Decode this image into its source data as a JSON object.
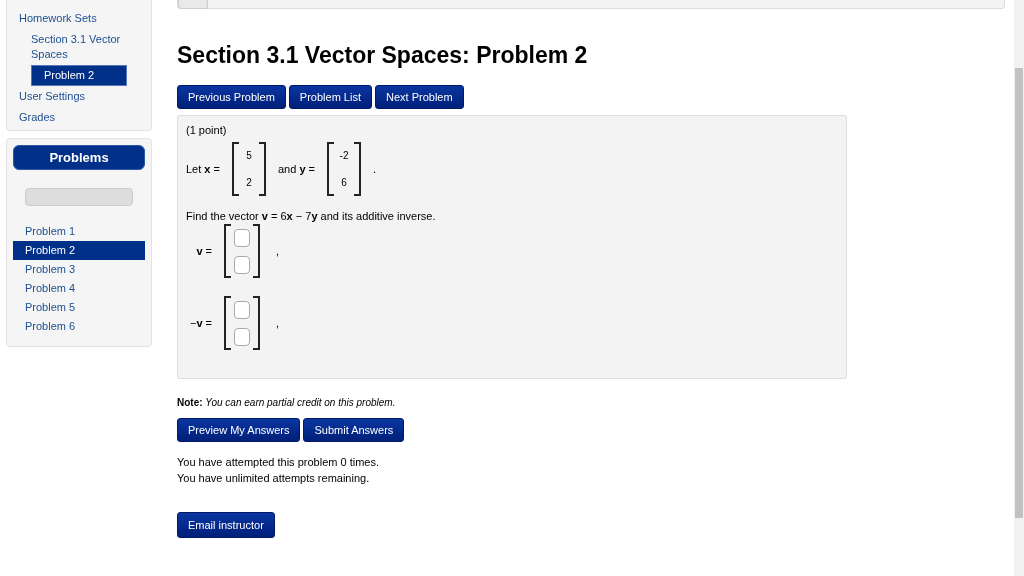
{
  "nav": {
    "items": [
      {
        "label": "Homework Sets",
        "selected": false,
        "children": [
          {
            "label": "Section 3.1 Vector Spaces",
            "selected": false,
            "children": [
              {
                "label": "Problem 2",
                "selected": true
              }
            ]
          }
        ]
      },
      {
        "label": "User Settings",
        "selected": false
      },
      {
        "label": "Grades",
        "selected": false
      }
    ]
  },
  "problems_panel": {
    "title": "Problems",
    "progress": {
      "level": 0
    },
    "items": [
      {
        "label": "Problem 1",
        "selected": false
      },
      {
        "label": "Problem 2",
        "selected": true
      },
      {
        "label": "Problem 3",
        "selected": false
      },
      {
        "label": "Problem 4",
        "selected": false
      },
      {
        "label": "Problem 5",
        "selected": false
      },
      {
        "label": "Problem 6",
        "selected": false
      }
    ]
  },
  "title": "Section 3.1 Vector Spaces: Problem 2",
  "nav_buttons": [
    "Previous Problem",
    "Problem List",
    "Next Problem"
  ],
  "problem": {
    "points": "(1 point)",
    "vectors": [
      {
        "label": "Let **x** =",
        "values": [
          "5",
          "2"
        ]
      },
      {
        "label": "and **y** =",
        "values": [
          "-2",
          "6"
        ]
      }
    ],
    "vectors_end": ".",
    "statement": "Find the vector **v** = 6**x** − 7**y** and its additive inverse.",
    "answers": [
      {
        "label": "**v** =",
        "end": ","
      },
      {
        "label": "−**v** =",
        "end": ","
      }
    ]
  },
  "note": "**Note:** *You can earn partial credit on this problem.*",
  "submit_buttons": [
    "Preview My Answers",
    "Submit Answers"
  ],
  "attempts": [
    "You have attempted this problem 0 times.",
    "You have unlimited attempts remaining."
  ],
  "email_button": "Email instructor"
}
